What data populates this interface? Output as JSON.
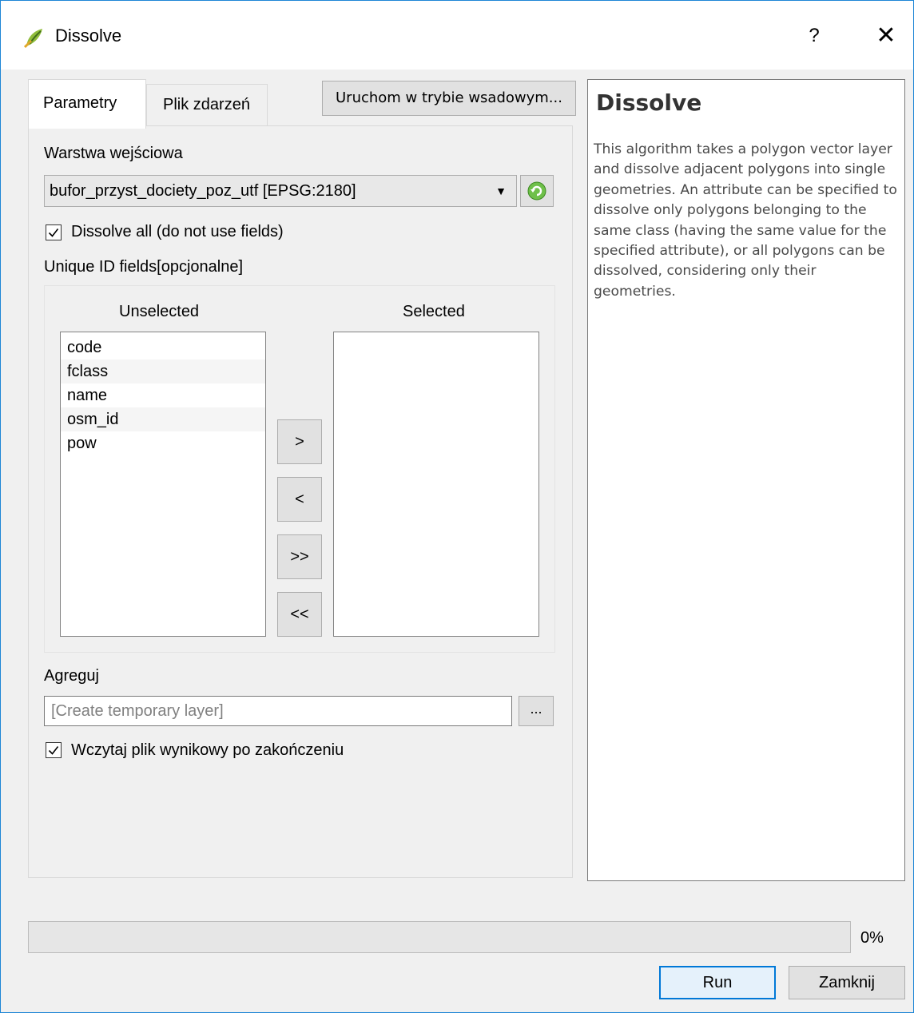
{
  "window": {
    "title": "Dissolve",
    "help_symbol": "?",
    "close_symbol": "✕",
    "icon": "qgis-icon"
  },
  "tabs": [
    {
      "label": "Parametry",
      "active": true
    },
    {
      "label": "Plik zdarzeń",
      "active": false
    }
  ],
  "batch_button": "Uruchom w trybie wsadowym...",
  "input_layer": {
    "label": "Warstwa wejściowa",
    "value": "bufor_przyst_dociety_poz_utf [EPSG:2180]",
    "dropdown_symbol": "▼",
    "refresh_icon": "refresh-icon"
  },
  "dissolve_all": {
    "label": "Dissolve all (do not use fields)",
    "checked": true
  },
  "fields": {
    "label": "Unique ID fields[opcjonalne]",
    "unselected_header": "Unselected",
    "selected_header": "Selected",
    "unselected": [
      "code",
      "fclass",
      "name",
      "osm_id",
      "pow"
    ],
    "selected": []
  },
  "move_buttons": {
    "add": ">",
    "remove": "<",
    "add_all": ">>",
    "remove_all": "<<"
  },
  "output": {
    "label": "Agreguj",
    "placeholder": "[Create temporary layer]",
    "browse_label": "..."
  },
  "load_result": {
    "label": "Wczytaj plik wynikowy po zakończeniu",
    "checked": true
  },
  "help": {
    "title": "Dissolve",
    "description": "This algorithm takes a polygon vector layer and dissolve adjacent polygons into single geometries. An attribute can be specified to dissolve only polygons belonging to the same class (having the same value for the specified attribute), or all polygons can be dissolved, considering only their geometries."
  },
  "progress": {
    "value": 0,
    "label": "0%"
  },
  "buttons": {
    "run": "Run",
    "close": "Zamknij"
  },
  "colors": {
    "accent": "#0078d7",
    "window_border": "#1e86d6",
    "progress": "#06b025"
  }
}
